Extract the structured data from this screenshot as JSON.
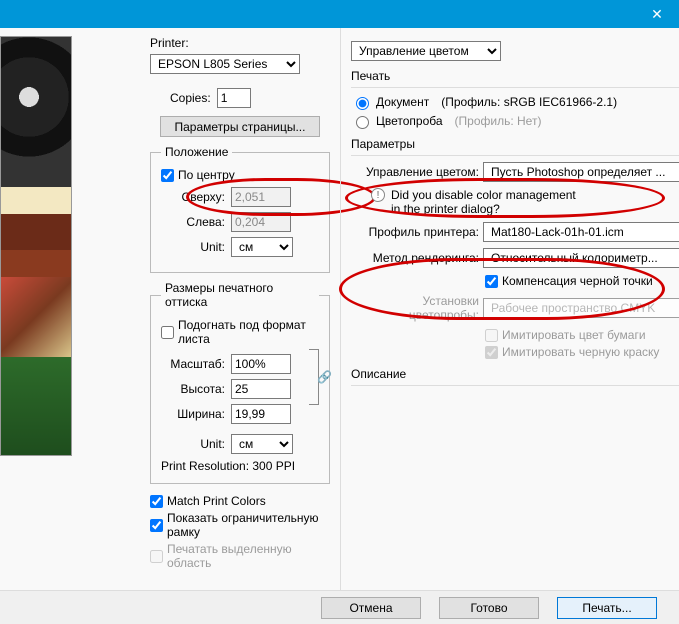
{
  "titlebar": {
    "close_glyph": "✕"
  },
  "left": {
    "printer_label": "Printer:",
    "printer_value": "EPSON L805 Series",
    "copies_label": "Copies:",
    "copies_value": "1",
    "page_setup_btn": "Параметры страницы...",
    "position": {
      "legend": "Положение",
      "center_label": "По центру",
      "center_checked": true,
      "top_label": "Сверху:",
      "top_value": "2,051",
      "left_label": "Слева:",
      "left_value": "0,204",
      "unit_label": "Unit:",
      "unit_value": "см"
    },
    "scaled_size": {
      "legend": "Размеры печатного оттиска",
      "fit_label": "Подогнать под формат листа",
      "fit_checked": false,
      "scale_label": "Масштаб:",
      "scale_value": "100%",
      "height_label": "Высота:",
      "height_value": "25",
      "width_label": "Ширина:",
      "width_value": "19,99",
      "unit_label": "Unit:",
      "unit_value": "см",
      "resolution_label": "Print Resolution: 300 PPI"
    },
    "match_colors_label": "Match Print Colors",
    "match_colors_checked": true,
    "show_bbox_label": "Показать ограничительную рамку",
    "show_bbox_checked": true,
    "print_selection_label": "Печатать выделенную область",
    "print_selection_checked": false
  },
  "right": {
    "top_select": "Управление цветом",
    "print_heading": "Печать",
    "doc_label": "Документ",
    "doc_profile": "(Профиль: sRGB IEC61966-2.1)",
    "proof_label": "Цветопроба",
    "proof_profile": "(Профиль: Нет)",
    "params_heading": "Параметры",
    "color_handling_label": "Управление цветом:",
    "color_handling_value": "Пусть Photoshop определяет ...",
    "disable_q1": "Did you disable color management",
    "disable_q2": "in the printer dialog?",
    "printer_profile_label": "Профиль принтера:",
    "printer_profile_value": "Mat180-Lack-01h-01.icm",
    "rendering_label": "Метод рендеринга:",
    "rendering_value": "Относительный колориметр...",
    "bpc_label": "Компенсация черной точки",
    "bpc_checked": true,
    "proof_setup_label": "Установки цветопробы:",
    "proof_setup_value": "Рабочее пространство CMYK",
    "sim_paper_label": "Имитировать цвет бумаги",
    "sim_black_label": "Имитировать черную краску",
    "sim_black_checked": true,
    "description_heading": "Описание"
  },
  "footer": {
    "cancel": "Отмена",
    "done": "Готово",
    "print": "Печать..."
  }
}
